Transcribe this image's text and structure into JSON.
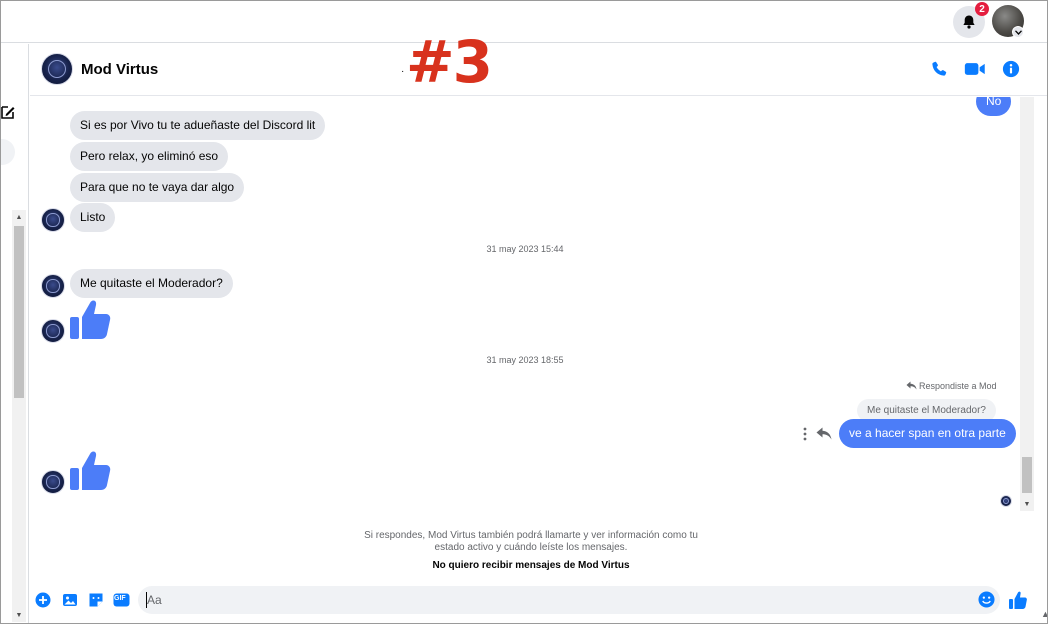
{
  "topbar": {
    "notification_count": "2",
    "icons": [
      "bell-icon",
      "profile-avatar",
      "chevron-down-icon"
    ]
  },
  "overlay_label": "#3",
  "header": {
    "contact_name": "Mod Virtus",
    "separator": "·",
    "icons": [
      "phone-icon",
      "video-icon",
      "info-icon"
    ]
  },
  "messages": {
    "partial_outgoing": "No",
    "incoming_group_1": [
      "Si es por Vivo tu te adueñaste del Discord lit",
      "Pero relax, yo eliminó eso",
      "Para que no te vaya dar algo",
      "Listo"
    ],
    "timestamp_1": "31 may 2023 15:44",
    "incoming_2": "Me quitaste el Moderador?",
    "timestamp_2": "31 may 2023 18:55",
    "reply_label": "Respondiste a Mod",
    "reply_quoted": "Me quitaste el Moderador?",
    "outgoing_reply": "ve a hacer span en otra parte"
  },
  "notice": {
    "line1": "Si respondes, Mod Virtus también podrá llamarte y ver información como tu",
    "line2": "estado activo y cuándo leíste los mensajes.",
    "block_link": "No quiero recibir mensajes de Mod Virtus"
  },
  "composer": {
    "placeholder": "Aa",
    "icons": [
      "plus-icon",
      "photo-icon",
      "sticker-icon",
      "gif-icon",
      "emoji-icon",
      "like-icon"
    ],
    "gif_label": "GIF"
  },
  "colors": {
    "accent": "#4c7df8",
    "messenger_blue": "#0a7cff",
    "incoming_bubble": "#e4e6eb",
    "overlay_red": "#d8321d",
    "badge_red": "#e41e3f"
  }
}
